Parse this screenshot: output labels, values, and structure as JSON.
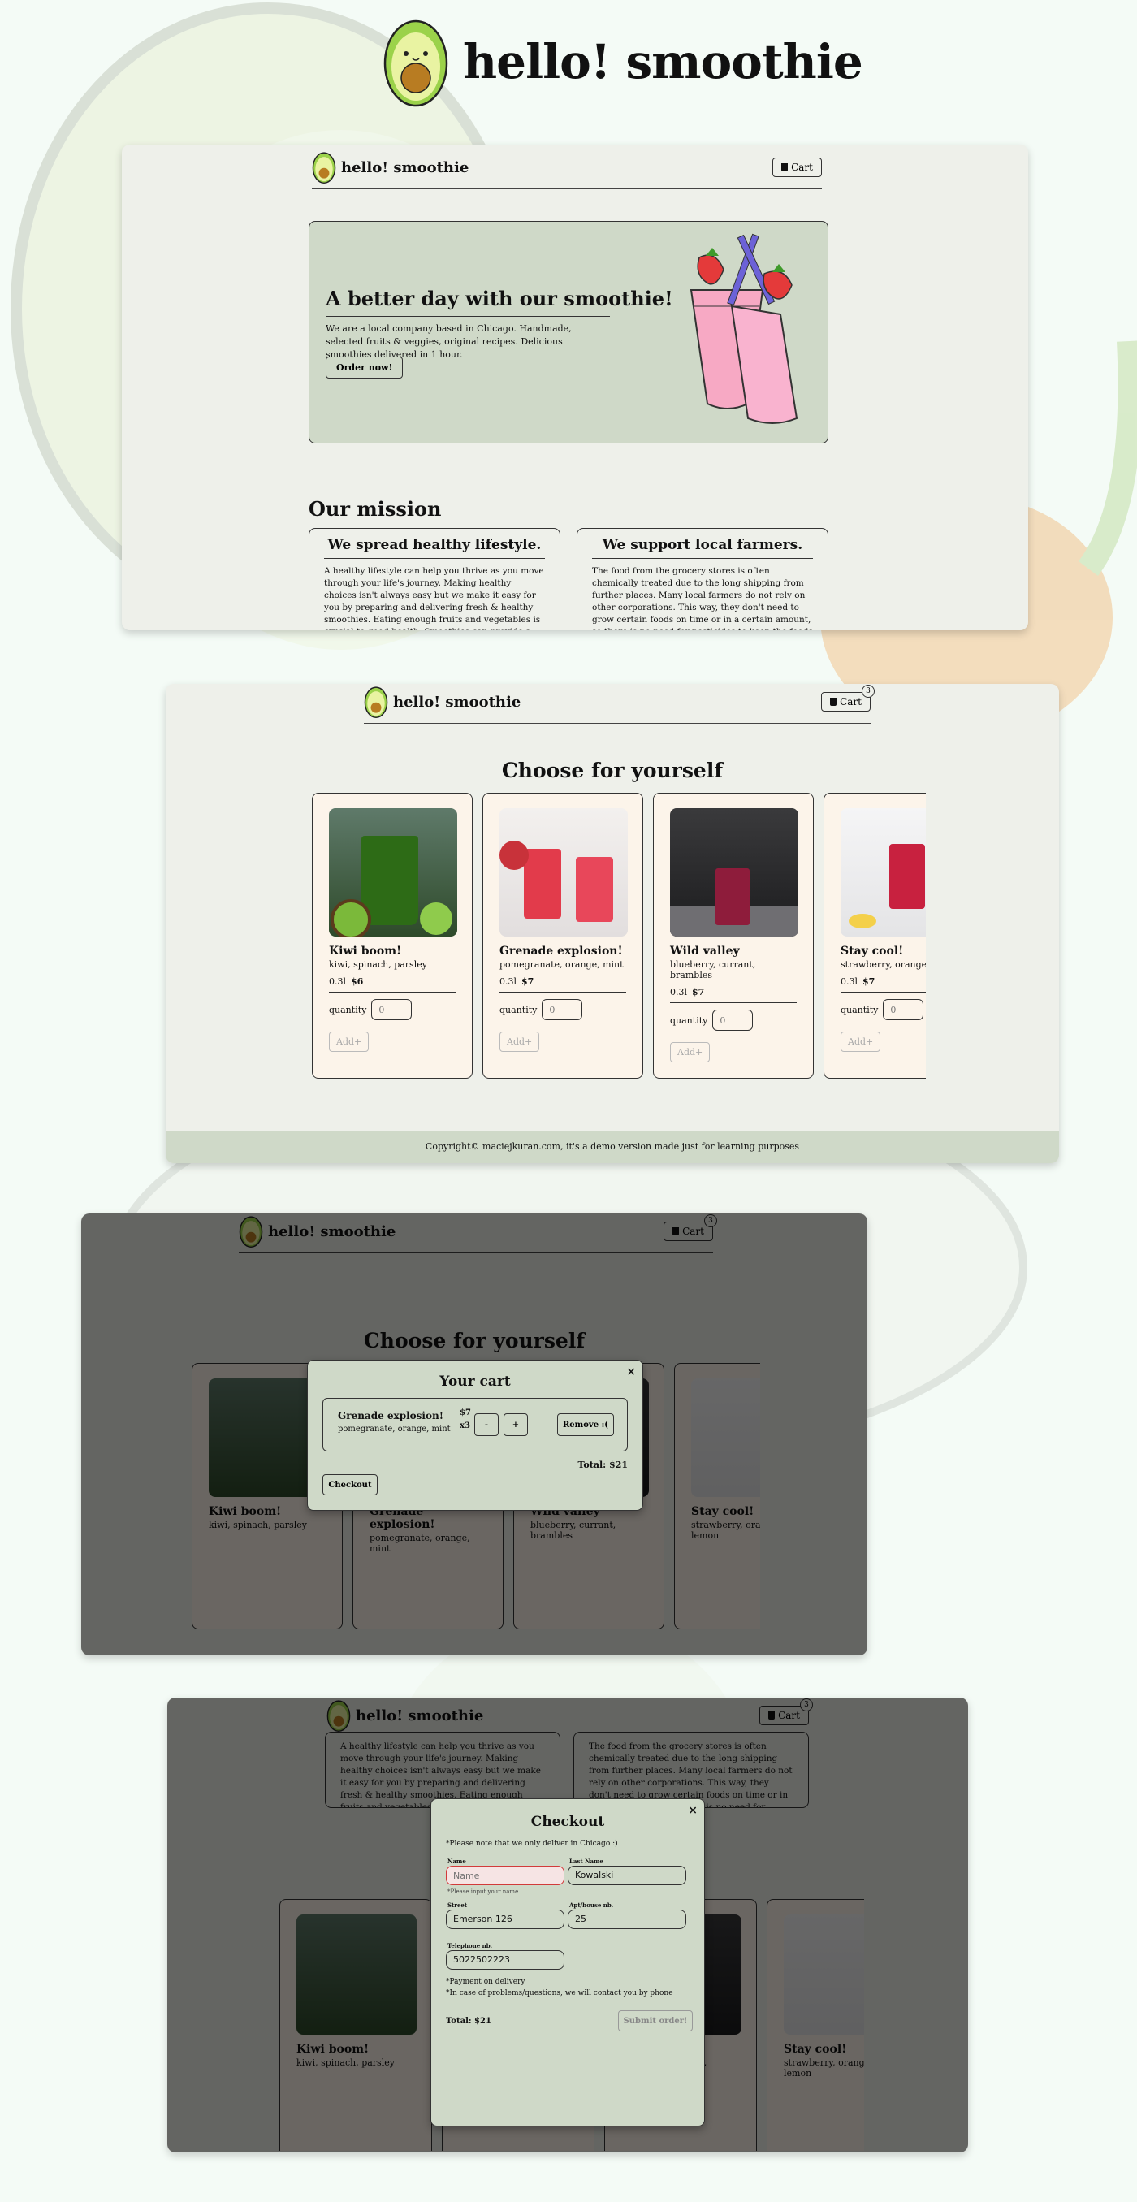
{
  "brand": {
    "name": "hello! smoothie"
  },
  "colors": {
    "panel": "#eef0ea",
    "accent_green": "#cfd9c8",
    "card_bg": "#fcf4ea",
    "page_bg": "#f4fbf6"
  },
  "nav": {
    "cart_label": "Cart",
    "cart_count": "3"
  },
  "hero": {
    "heading": "A better day with our smoothie!",
    "text": "We are a local company based in Chicago. Handmade, selected fruits & veggies, original recipes. Delicious smoothies delivered in 1 hour.",
    "button": "Order now!"
  },
  "mission": {
    "title": "Our mission",
    "cards": [
      {
        "title": "We spread healthy lifestyle.",
        "text": "A healthy lifestyle can help you thrive as you move through your life's journey. Making healthy choices isn't always easy but we make it easy for you by preparing and delivering fresh & healthy smoothies. Eating enough fruits and vegetables is crucial to good health. Smoothies can provide a source of energy and protein."
      },
      {
        "title": "We support local farmers.",
        "text": "The food from the grocery stores is often chemically treated due to the long shipping from further places. Many local farmers do not rely on other corporations. This way, they don't need to grow certain foods on time or in a certain amount, so there is no need for pesticides to keep the foods fresh for longer."
      }
    ]
  },
  "shop": {
    "title": "Choose for yourself",
    "quantity_label": "quantity",
    "quantity_placeholder": "0",
    "add_label": "Add+",
    "products": [
      {
        "name": "Kiwi boom!",
        "ingredients": "kiwi, spinach, parsley",
        "size": "0.3l",
        "price": "$6"
      },
      {
        "name": "Grenade explosion!",
        "ingredients": "pomegranate, orange, mint",
        "size": "0.3l",
        "price": "$7"
      },
      {
        "name": "Wild valley",
        "ingredients": "blueberry, currant, brambles",
        "size": "0.3l",
        "price": "$7"
      },
      {
        "name": "Stay cool!",
        "ingredients": "strawberry, orange, lemon",
        "size": "0.3l",
        "price": "$7"
      }
    ]
  },
  "footer": {
    "text": "Copyright© maciejkuran.com, it's a demo version made just for learning purposes"
  },
  "cart_modal": {
    "title": "Your cart",
    "close": "×",
    "item": {
      "name": "Grenade explosion!",
      "ingredients": "pomegranate, orange, mint",
      "price": "$7",
      "qty": "x3"
    },
    "minus": "-",
    "plus": "+",
    "remove": "Remove :(",
    "total": "Total: $21",
    "checkout": "Checkout"
  },
  "checkout_modal": {
    "title": "Checkout",
    "close": "×",
    "note": "*Please note that we only deliver in Chicago :)",
    "name_label": "Name",
    "name_placeholder": "Name",
    "name_error": "*Please input your name.",
    "lastname_label": "Last Name",
    "lastname_value": "Kowalski",
    "street_label": "Street",
    "street_value": "Emerson 126",
    "apt_label": "Apt/house nb.",
    "apt_value": "25",
    "phone_label": "Telephone nb.",
    "phone_value": "5022502223",
    "payment_note": "*Payment on delivery",
    "contact_note": "*In case of problems/questions, we will contact you by phone",
    "total": "Total: $21",
    "submit": "Submit order!"
  }
}
